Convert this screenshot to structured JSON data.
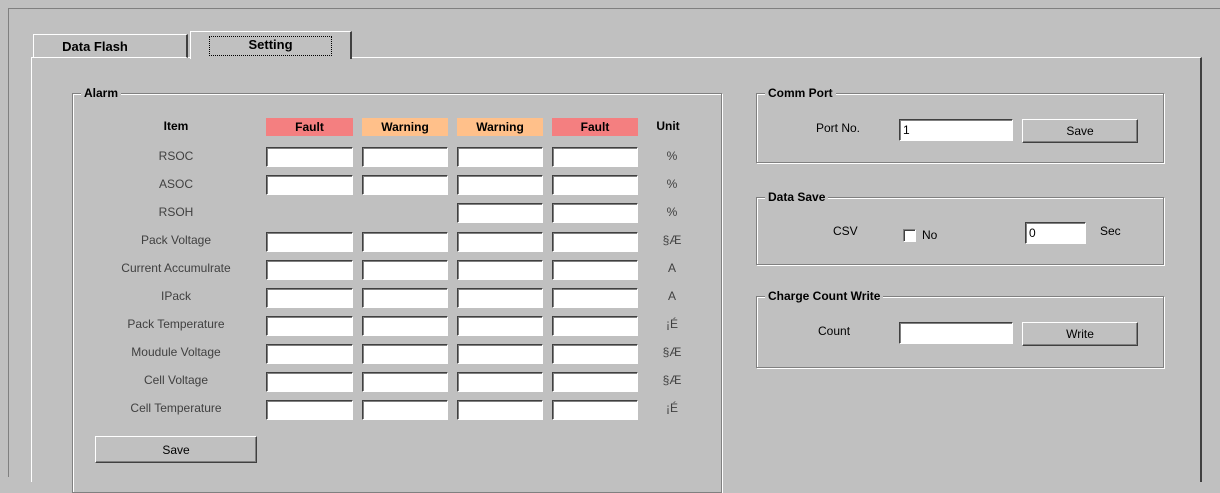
{
  "tabs": [
    {
      "label": "Data Flash",
      "active": false
    },
    {
      "label": "Setting",
      "active": true
    }
  ],
  "alarm": {
    "title": "Alarm",
    "headers": {
      "item": "Item",
      "fault1": "Fault",
      "warning1": "Warning",
      "warning2": "Warning",
      "fault2": "Fault",
      "unit": "Unit"
    },
    "header_colors": {
      "fault": "#f47f80",
      "warning": "#ffc08a"
    },
    "rows": [
      {
        "label": "RSOC",
        "unit": "%"
      },
      {
        "label": "ASOC",
        "unit": "%"
      },
      {
        "label": "RSOH",
        "unit": "%"
      },
      {
        "label": "Pack Voltage",
        "unit": "§Æ"
      },
      {
        "label": "Current Accumulrate",
        "unit": "A"
      },
      {
        "label": "IPack",
        "unit": "A"
      },
      {
        "label": "Pack Temperature",
        "unit": "¡É"
      },
      {
        "label": "Moudule Voltage",
        "unit": "§Æ"
      },
      {
        "label": "Cell Voltage",
        "unit": "§Æ"
      },
      {
        "label": "Cell Temperature",
        "unit": "¡É"
      }
    ],
    "save_label": "Save"
  },
  "comm_port": {
    "title": "Comm Port",
    "port_label": "Port No.",
    "port_value": "1",
    "save_label": "Save"
  },
  "data_save": {
    "title": "Data Save",
    "csv_label": "CSV",
    "checkbox_label": "No",
    "checkbox_checked": false,
    "interval_value": "0",
    "interval_unit": "Sec"
  },
  "charge_count": {
    "title": "Charge Count Write",
    "count_label": "Count",
    "count_value": "",
    "write_label": "Write"
  }
}
